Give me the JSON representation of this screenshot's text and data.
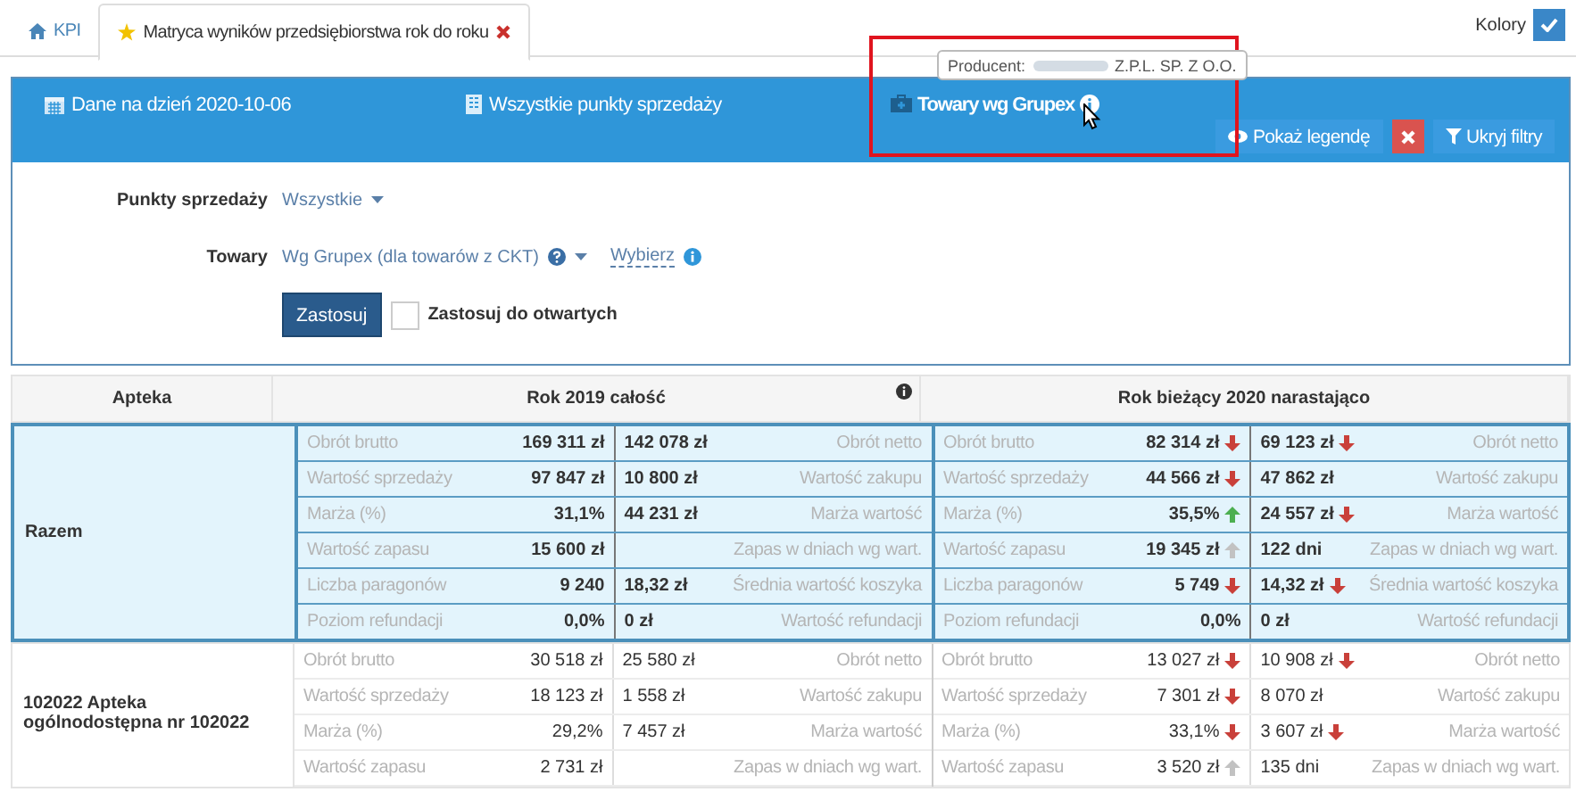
{
  "tabs": [
    {
      "label": "KPI",
      "selected": false,
      "closable": false
    },
    {
      "label": "Matryca wyników przedsiębiorstwa rok do roku",
      "selected": true,
      "closable": true
    }
  ],
  "colors_toggle": {
    "label": "Kolory",
    "checked": true
  },
  "header": {
    "items": [
      {
        "kind": "date",
        "text": "Dane na dzień 2020-10-06"
      },
      {
        "kind": "store",
        "text": "Wszystkie punkty sprzedaży"
      },
      {
        "kind": "goods",
        "text": "Towary wg Grupex"
      }
    ],
    "tooltip": {
      "prefix": "Producent:",
      "suffix": "Z.P.L. SP. Z O.O."
    },
    "buttons": [
      {
        "kind": "legend",
        "label": "Pokaż legendę"
      },
      {
        "kind": "clear"
      },
      {
        "kind": "filter",
        "label": "Ukryj filtry"
      }
    ]
  },
  "filters": {
    "rows": [
      {
        "label": "Punkty sprzedaży",
        "value": "Wszystkie"
      },
      {
        "label": "Towary",
        "value": "Wg Grupex (dla towarów z CKT)",
        "link": "Wybierz"
      }
    ],
    "apply": "Zastosuj",
    "apply_open": {
      "label": "Zastosuj do otwartych",
      "checked": false
    }
  },
  "table": {
    "columns": [
      {
        "label": "Apteka",
        "info": false
      },
      {
        "label": "Rok 2019 całość",
        "info": true
      },
      {
        "label": "Rok bieżący 2020 narastająco",
        "info": false
      }
    ],
    "groups": [
      {
        "name": "Razem",
        "summary": true,
        "rows": [
          [
            {
              "label": "Obrót brutto",
              "value": "169 311 zł",
              "value_2": "142 078 zł",
              "label_2": "Obrót netto"
            },
            {
              "label": "Obrót brutto",
              "value": "82 314 zł",
              "arrow": {
                "up": false,
                "color": "#c9403a"
              },
              "value_2": "69 123 zł",
              "arrow_2": {
                "up": false,
                "color": "#c9403a"
              },
              "label_2": "Obrót netto"
            }
          ],
          [
            {
              "label": "Wartość sprzedaży",
              "value": "97 847 zł",
              "value_2": "10 800 zł",
              "label_2": "Wartość zakupu"
            },
            {
              "label": "Wartość sprzedaży",
              "value": "44 566 zł",
              "arrow": {
                "up": false,
                "color": "#c9403a"
              },
              "value_2": "47 862 zł",
              "label_2": "Wartość zakupu"
            }
          ],
          [
            {
              "label": "Marża (%)",
              "value": "31,1%",
              "value_2": "44 231 zł",
              "label_2": "Marża wartość"
            },
            {
              "label": "Marża (%)",
              "value": "35,5%",
              "arrow": {
                "up": true,
                "color": "#4caf50"
              },
              "value_2": "24 557 zł",
              "arrow_2": {
                "up": false,
                "color": "#c9403a"
              },
              "label_2": "Marża wartość"
            }
          ],
          [
            {
              "label": "Wartość zapasu",
              "value": "15 600 zł",
              "label_2": "Zapas w dniach wg wart."
            },
            {
              "label": "Wartość zapasu",
              "value": "19 345 zł",
              "arrow": {
                "up": true,
                "color": "#c2c2c2"
              },
              "value_2": "122 dni",
              "label_2": "Zapas w dniach wg wart."
            }
          ],
          [
            {
              "label": "Liczba paragonów",
              "value": "9 240",
              "value_2": "18,32 zł",
              "label_2": "Średnia wartość koszyka"
            },
            {
              "label": "Liczba paragonów",
              "value": "5 749",
              "arrow": {
                "up": false,
                "color": "#c9403a"
              },
              "value_2": "14,32 zł",
              "arrow_2": {
                "up": false,
                "color": "#c9403a"
              },
              "label_2": "Średnia wartość koszyka"
            }
          ],
          [
            {
              "label": "Poziom refundacji",
              "value": "0,0%",
              "value_2": "0 zł",
              "label_2": "Wartość refundacji"
            },
            {
              "label": "Poziom refundacji",
              "value": "0,0%",
              "value_2": "0 zł",
              "label_2": "Wartość refundacji"
            }
          ]
        ]
      },
      {
        "name": "102022 Apteka ogólnodostępna nr 102022",
        "summary": false,
        "rows": [
          [
            {
              "label": "Obrót brutto",
              "value": "30 518 zł",
              "value_2": "25 580 zł",
              "label_2": "Obrót netto"
            },
            {
              "label": "Obrót brutto",
              "value": "13 027 zł",
              "arrow": {
                "up": false,
                "color": "#c9403a"
              },
              "value_2": "10 908 zł",
              "arrow_2": {
                "up": false,
                "color": "#c9403a"
              },
              "label_2": "Obrót netto"
            }
          ],
          [
            {
              "label": "Wartość sprzedaży",
              "value": "18 123 zł",
              "value_2": "1 558 zł",
              "label_2": "Wartość zakupu"
            },
            {
              "label": "Wartość sprzedaży",
              "value": "7 301 zł",
              "arrow": {
                "up": false,
                "color": "#c9403a"
              },
              "value_2": "8 070 zł",
              "label_2": "Wartość zakupu"
            }
          ],
          [
            {
              "label": "Marża (%)",
              "value": "29,2%",
              "value_2": "7 457 zł",
              "label_2": "Marża wartość"
            },
            {
              "label": "Marża (%)",
              "value": "33,1%",
              "arrow": {
                "up": false,
                "color": "#c9403a"
              },
              "value_2": "3 607 zł",
              "arrow_2": {
                "up": false,
                "color": "#c9403a"
              },
              "label_2": "Marża wartość"
            }
          ],
          [
            {
              "label": "Wartość zapasu",
              "value": "2 731 zł",
              "label_2": "Zapas w dniach wg wart."
            },
            {
              "label": "Wartość zapasu",
              "value": "3 520 zł",
              "arrow": {
                "up": true,
                "color": "#c2c2c2"
              },
              "value_2": "135 dni",
              "label_2": "Zapas w dniach wg wart."
            }
          ]
        ]
      }
    ]
  }
}
